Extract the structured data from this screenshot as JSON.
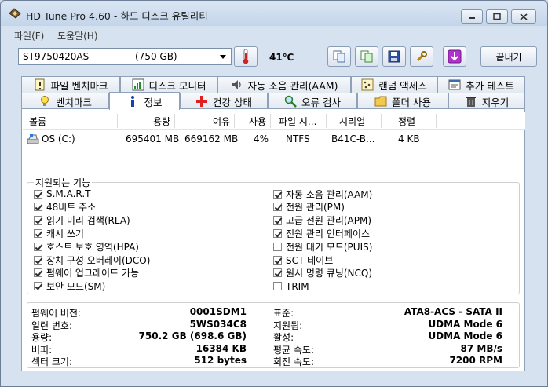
{
  "window": {
    "title": "HD Tune Pro 4.60 - 하드 디스크 유틸리티"
  },
  "menu": {
    "file": "파일(F)",
    "help": "도움말(H)"
  },
  "toolbar": {
    "drive_name": "ST9750420AS",
    "drive_capacity": "(750 GB)",
    "temperature": "41℃",
    "exit_label": "끝내기"
  },
  "tabs_row1": [
    {
      "label": "파일 벤치마크",
      "icon": "file-benchmark-icon"
    },
    {
      "label": "디스크 모니터",
      "icon": "disk-monitor-icon"
    },
    {
      "label": "자동 소음 관리(AAM)",
      "icon": "speaker-icon"
    },
    {
      "label": "랜덤 액세스",
      "icon": "random-access-icon"
    },
    {
      "label": "추가 테스트",
      "icon": "extra-tests-icon"
    }
  ],
  "tabs_row2": [
    {
      "label": "벤치마크",
      "icon": "benchmark-bulb-icon"
    },
    {
      "label": "정보",
      "icon": "info-icon"
    },
    {
      "label": "건강 상태",
      "icon": "health-cross-icon"
    },
    {
      "label": "오류 검사",
      "icon": "magnifier-icon"
    },
    {
      "label": "폴더 사용",
      "icon": "folder-icon"
    },
    {
      "label": "지우기",
      "icon": "trash-icon"
    }
  ],
  "volume_table": {
    "headers": [
      "볼륨",
      "용량",
      "여유",
      "사용",
      "파일 시...",
      "시리얼",
      "정렬"
    ],
    "rows": [
      {
        "volume": "OS (C:)",
        "capacity": "695401 MB",
        "free": "669162 MB",
        "used": "4%",
        "fs": "NTFS",
        "serial": "B41C-B...",
        "align": "4 KB"
      }
    ]
  },
  "features": {
    "title": "지원되는 기능",
    "left": [
      {
        "label": "S.M.A.R.T",
        "checked": true
      },
      {
        "label": "48비트 주소",
        "checked": true
      },
      {
        "label": "읽기 미리 검색(RLA)",
        "checked": true
      },
      {
        "label": "캐시 쓰기",
        "checked": true
      },
      {
        "label": "호스트 보호 영역(HPA)",
        "checked": true
      },
      {
        "label": "장치 구성 오버레이(DCO)",
        "checked": true
      },
      {
        "label": "펌웨어 업그레이드 가능",
        "checked": true
      },
      {
        "label": "보안 모드(SM)",
        "checked": true
      }
    ],
    "right": [
      {
        "label": "자동 소음 관리(AAM)",
        "checked": true
      },
      {
        "label": "전원 관리(PM)",
        "checked": true
      },
      {
        "label": "고급 전원 관리(APM)",
        "checked": true
      },
      {
        "label": "전원 관리 인터페이스",
        "checked": true
      },
      {
        "label": "전원 대기 모드(PUIS)",
        "checked": false
      },
      {
        "label": "SCT 테이브",
        "checked": true
      },
      {
        "label": "원시 명령 큐닝(NCQ)",
        "checked": true
      },
      {
        "label": "TRIM",
        "checked": false
      }
    ]
  },
  "info": {
    "left": [
      {
        "label": "펌웨어 버전:",
        "value": "0001SDM1"
      },
      {
        "label": "일련 번호:",
        "value": "5WS034C8"
      },
      {
        "label": "용량:",
        "value": "750.2 GB (698.6 GB)"
      },
      {
        "label": "버퍼:",
        "value": "16384 KB"
      },
      {
        "label": "섹터 크기:",
        "value": "512 bytes"
      }
    ],
    "right": [
      {
        "label": "표준:",
        "value": "ATA8-ACS - SATA II"
      },
      {
        "label": "지원됨:",
        "value": "UDMA Mode 6"
      },
      {
        "label": "활성:",
        "value": "UDMA Mode 6"
      },
      {
        "label": "평균 속도:",
        "value": "87 MB/s"
      },
      {
        "label": "회전 속도:",
        "value": "7200 RPM"
      }
    ]
  }
}
